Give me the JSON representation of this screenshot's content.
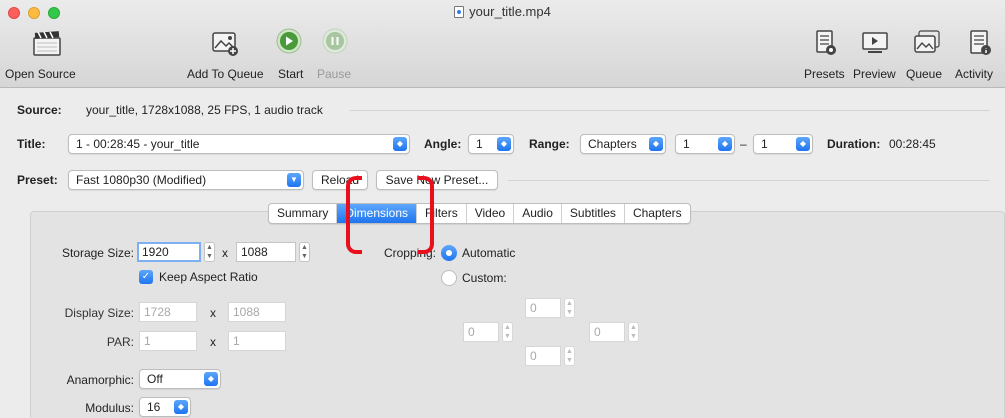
{
  "window": {
    "title": "your_title.mp4"
  },
  "toolbar": {
    "open_source": "Open Source",
    "add_to_queue": "Add To Queue",
    "start": "Start",
    "pause": "Pause",
    "presets": "Presets",
    "preview": "Preview",
    "queue": "Queue",
    "activity": "Activity"
  },
  "source": {
    "label": "Source:",
    "value": "your_title, 1728x1088, 25 FPS, 1 audio track"
  },
  "title_row": {
    "label": "Title:",
    "value": "1 - 00:28:45 - your_title",
    "angle_label": "Angle:",
    "angle_value": "1",
    "range_label": "Range:",
    "range_type": "Chapters",
    "range_start": "1",
    "range_dash": "–",
    "range_end": "1",
    "duration_label": "Duration:",
    "duration_value": "00:28:45"
  },
  "preset": {
    "label": "Preset:",
    "value": "Fast 1080p30 (Modified)",
    "reload": "Reload",
    "save_new": "Save New Preset..."
  },
  "tabs": [
    {
      "label": "Summary",
      "active": false
    },
    {
      "label": "Dimensions",
      "active": true
    },
    {
      "label": "Filters",
      "active": false
    },
    {
      "label": "Video",
      "active": false
    },
    {
      "label": "Audio",
      "active": false
    },
    {
      "label": "Subtitles",
      "active": false
    },
    {
      "label": "Chapters",
      "active": false
    }
  ],
  "dimensions": {
    "storage_label": "Storage Size:",
    "storage_width": "1920",
    "storage_height": "1088",
    "x": "x",
    "keep_aspect": "Keep Aspect Ratio",
    "display_label": "Display Size:",
    "display_width": "1728",
    "display_height": "1088",
    "par_label": "PAR:",
    "par_width": "1",
    "par_height": "1",
    "anamorphic_label": "Anamorphic:",
    "anamorphic_value": "Off",
    "modulus_label": "Modulus:",
    "modulus_value": "16"
  },
  "cropping": {
    "label": "Cropping:",
    "automatic": "Automatic",
    "custom": "Custom:",
    "top": "0",
    "left": "0",
    "right": "0",
    "bottom": "0"
  },
  "colors": {
    "accent": "#1f75f0",
    "annotation": "#e8101c"
  }
}
